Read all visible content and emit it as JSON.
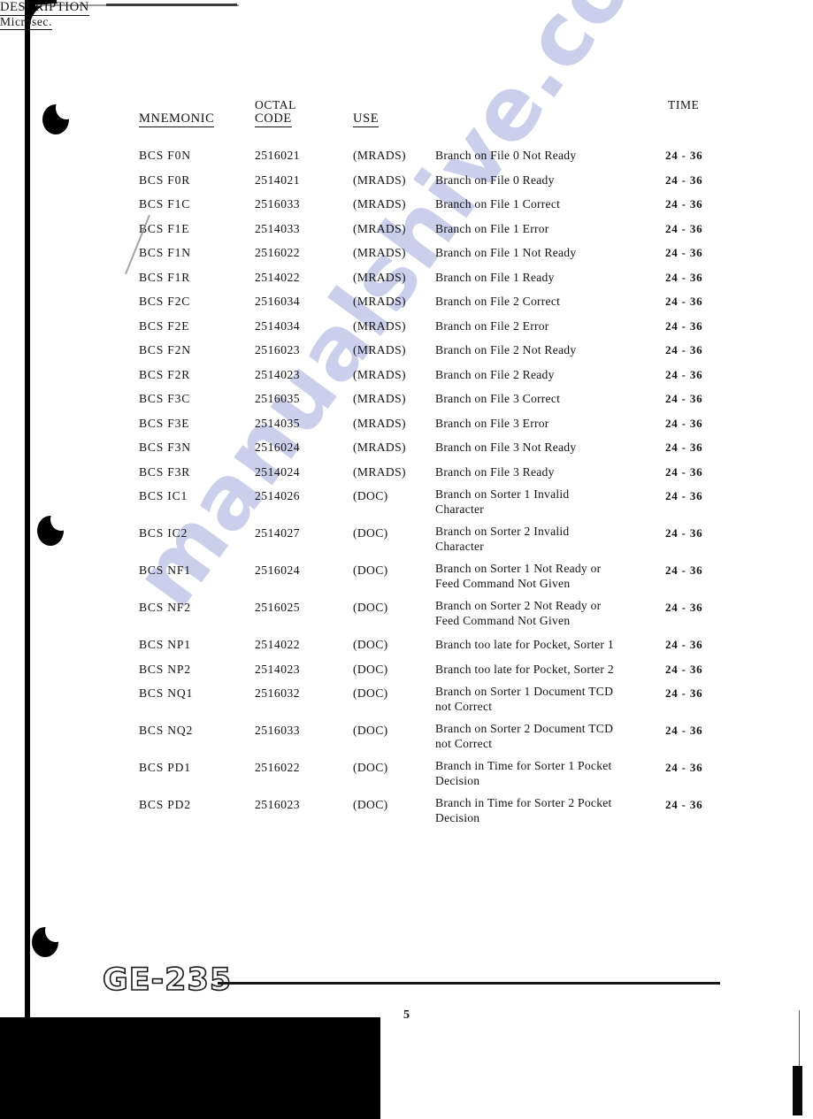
{
  "document": {
    "footer_logo": "GE-235",
    "page_number": "5",
    "watermark": "manualshive.com"
  },
  "table": {
    "headers": {
      "mnemonic": "MNEMONIC",
      "octal_line1": "OCTAL",
      "octal_line2": "CODE",
      "use": "USE",
      "description": "DESCRIPTION",
      "time_line1": "TIME",
      "time_line2": "Microsec."
    },
    "rows": [
      {
        "mnemonic": "BCS F0N",
        "octal": "2516021",
        "use": "(MRADS)",
        "desc1": "Branch on File 0 Not Ready",
        "desc2": "",
        "time": "24 - 36"
      },
      {
        "mnemonic": "BCS F0R",
        "octal": "2514021",
        "use": "(MRADS)",
        "desc1": "Branch on File 0 Ready",
        "desc2": "",
        "time": "24 - 36"
      },
      {
        "mnemonic": "BCS F1C",
        "octal": "2516033",
        "use": "(MRADS)",
        "desc1": "Branch on File 1 Correct",
        "desc2": "",
        "time": "24 - 36"
      },
      {
        "mnemonic": "BCS F1E",
        "octal": "2514033",
        "use": "(MRADS)",
        "desc1": "Branch on File 1 Error",
        "desc2": "",
        "time": "24 - 36"
      },
      {
        "mnemonic": "BCS F1N",
        "octal": "2516022",
        "use": "(MRADS)",
        "desc1": "Branch on File 1 Not Ready",
        "desc2": "",
        "time": "24 - 36"
      },
      {
        "mnemonic": "BCS F1R",
        "octal": "2514022",
        "use": "(MRADS)",
        "desc1": "Branch on File 1 Ready",
        "desc2": "",
        "time": "24 - 36"
      },
      {
        "mnemonic": "BCS F2C",
        "octal": "2516034",
        "use": "(MRADS)",
        "desc1": "Branch on File 2 Correct",
        "desc2": "",
        "time": "24 - 36"
      },
      {
        "mnemonic": "BCS F2E",
        "octal": "2514034",
        "use": "(MRADS)",
        "desc1": "Branch on File 2 Error",
        "desc2": "",
        "time": "24 - 36"
      },
      {
        "mnemonic": "BCS F2N",
        "octal": "2516023",
        "use": "(MRADS)",
        "desc1": "Branch on File 2 Not Ready",
        "desc2": "",
        "time": "24 - 36"
      },
      {
        "mnemonic": "BCS F2R",
        "octal": "2514023",
        "use": "(MRADS)",
        "desc1": "Branch on File 2 Ready",
        "desc2": "",
        "time": "24 - 36"
      },
      {
        "mnemonic": "BCS F3C",
        "octal": "2516035",
        "use": "(MRADS)",
        "desc1": "Branch on File 3 Correct",
        "desc2": "",
        "time": "24 - 36"
      },
      {
        "mnemonic": "BCS F3E",
        "octal": "2514035",
        "use": "(MRADS)",
        "desc1": "Branch on File 3 Error",
        "desc2": "",
        "time": "24 - 36"
      },
      {
        "mnemonic": "BCS F3N",
        "octal": "2516024",
        "use": "(MRADS)",
        "desc1": "Branch on File 3 Not Ready",
        "desc2": "",
        "time": "24 - 36"
      },
      {
        "mnemonic": "BCS F3R",
        "octal": "2514024",
        "use": "(MRADS)",
        "desc1": "Branch on File 3 Ready",
        "desc2": "",
        "time": "24 - 36"
      },
      {
        "mnemonic": "BCS IC1",
        "octal": "2514026",
        "use": "(DOC)",
        "desc1": "Branch on Sorter 1 Invalid",
        "desc2": "Character",
        "time": "24 - 36"
      },
      {
        "mnemonic": "BCS IC2",
        "octal": "2514027",
        "use": "(DOC)",
        "desc1": "Branch on Sorter 2 Invalid",
        "desc2": "Character",
        "time": "24 - 36"
      },
      {
        "mnemonic": "BCS NF1",
        "octal": "2516024",
        "use": "(DOC)",
        "desc1": "Branch on Sorter 1 Not Ready or",
        "desc2": "Feed Command Not Given",
        "time": "24 - 36"
      },
      {
        "mnemonic": "BCS NF2",
        "octal": "2516025",
        "use": "(DOC)",
        "desc1": "Branch on Sorter 2 Not Ready or",
        "desc2": "Feed Command Not Given",
        "time": "24 - 36"
      },
      {
        "mnemonic": "BCS NP1",
        "octal": "2514022",
        "use": "(DOC)",
        "desc1": "Branch too late for Pocket,  Sorter 1",
        "desc2": "",
        "time": "24 - 36"
      },
      {
        "mnemonic": "BCS NP2",
        "octal": "2514023",
        "use": "(DOC)",
        "desc1": "Branch too late for Pocket,  Sorter 2",
        "desc2": "",
        "time": "24 - 36"
      },
      {
        "mnemonic": "BCS NQ1",
        "octal": "2516032",
        "use": "(DOC)",
        "desc1": "Branch on Sorter 1 Document TCD",
        "desc2": "not Correct",
        "time": "24 - 36"
      },
      {
        "mnemonic": "BCS NQ2",
        "octal": "2516033",
        "use": "(DOC)",
        "desc1": "Branch on Sorter 2 Document TCD",
        "desc2": "not Correct",
        "time": "24 - 36"
      },
      {
        "mnemonic": "BCS PD1",
        "octal": "2516022",
        "use": "(DOC)",
        "desc1": "Branch in Time for Sorter 1 Pocket",
        "desc2": "Decision",
        "time": "24 - 36"
      },
      {
        "mnemonic": "BCS PD2",
        "octal": "2516023",
        "use": "(DOC)",
        "desc1": "Branch in Time for Sorter 2 Pocket",
        "desc2": "Decision",
        "time": "24 - 36"
      }
    ]
  }
}
